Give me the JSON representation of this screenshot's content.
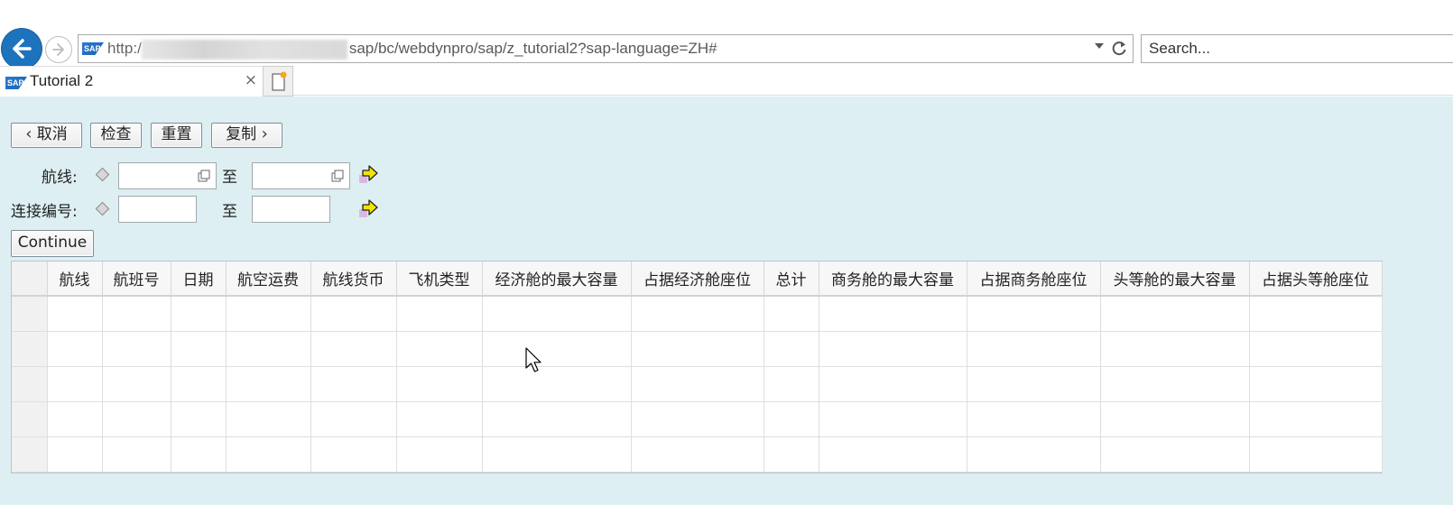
{
  "browser": {
    "url_prefix": "http:/",
    "url_path": "sap/bc/webdynpro/sap/z_tutorial2?sap-language=ZH#",
    "search_placeholder": "Search...",
    "tab_title": "Tutorial 2",
    "tab_close": "×",
    "sap_logo_text": "SAP"
  },
  "toolbar": {
    "cancel_label": "取消",
    "check_label": "检查",
    "reset_label": "重置",
    "copy_label": "复制"
  },
  "form": {
    "route_label": "航线:",
    "connection_label": "连接编号:",
    "to_label": "至",
    "route_from_value": "",
    "route_to_value": "",
    "connection_from_value": "",
    "connection_to_value": ""
  },
  "continue_label": "Continue",
  "table": {
    "columns": [
      "航线",
      "航班号",
      "日期",
      "航空运费",
      "航线货币",
      "飞机类型",
      "经济舱的最大容量",
      "占据经济舱座位",
      "总计",
      "商务舱的最大容量",
      "占据商务舱座位",
      "头等舱的最大容量",
      "占据头等舱座位"
    ],
    "rows": [
      [
        "",
        "",
        "",
        "",
        "",
        "",
        "",
        "",
        "",
        "",
        "",
        "",
        ""
      ],
      [
        "",
        "",
        "",
        "",
        "",
        "",
        "",
        "",
        "",
        "",
        "",
        "",
        ""
      ],
      [
        "",
        "",
        "",
        "",
        "",
        "",
        "",
        "",
        "",
        "",
        "",
        "",
        ""
      ],
      [
        "",
        "",
        "",
        "",
        "",
        "",
        "",
        "",
        "",
        "",
        "",
        "",
        ""
      ],
      [
        "",
        "",
        "",
        "",
        "",
        "",
        "",
        "",
        "",
        "",
        "",
        "",
        ""
      ]
    ]
  },
  "colors": {
    "content_bg": "#ddeff2",
    "back_button": "#1e73be",
    "go_arrow": "#f5e400"
  }
}
